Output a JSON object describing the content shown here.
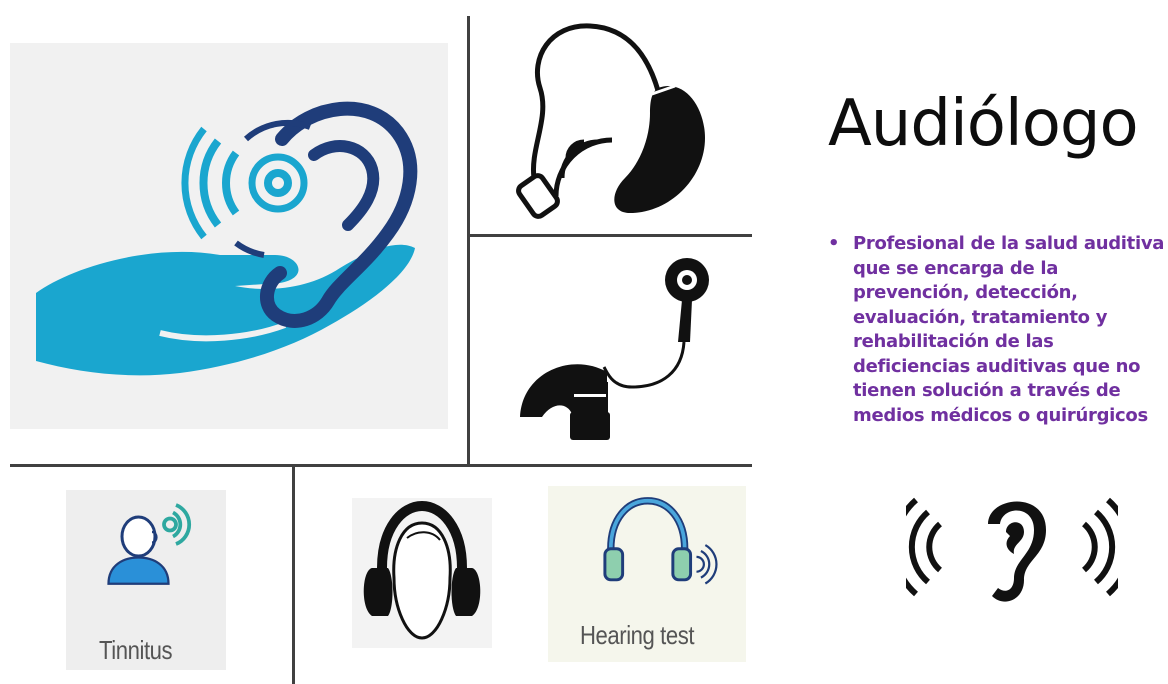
{
  "slide": {
    "title": "Audiólogo",
    "bullet_marker": "•",
    "bullet_text": "Profesional de la salud auditiva que se encarga de la prevención, detección, evaluación, tratamiento y rehabilitación de las deficiencias auditivas que no tienen solución a través de medios médicos o quirúrgicos"
  },
  "tiles": {
    "tinnitus_caption": "Tinnitus",
    "hearing_test_caption": "Hearing test"
  },
  "colors": {
    "accent_purple": "#7030a0",
    "cyan": "#1aa6cf",
    "navy": "#1f3d7a",
    "divider": "#404040"
  },
  "icons": [
    "hand-holding-ear-icon",
    "hearing-aid-icon",
    "cochlear-implant-icon",
    "tinnitus-person-icon",
    "ear-protectors-icon",
    "hearing-test-headphones-icon",
    "ear-sound-waves-icon"
  ]
}
